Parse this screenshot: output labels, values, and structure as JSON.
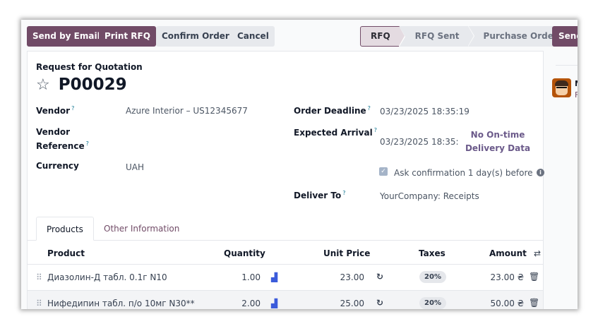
{
  "toolbar": {
    "send_by_email": "Send by Email",
    "print_rfq": "Print RFQ",
    "confirm_order": "Confirm Order",
    "cancel": "Cancel"
  },
  "status_bar": {
    "stages": [
      "RFQ",
      "RFQ Sent",
      "Purchase Order"
    ],
    "active_stage": "RFQ"
  },
  "right_panel": {
    "send_button": "Send",
    "name_initial": "M",
    "sub_initial": "F"
  },
  "form": {
    "doc_type": "Request for Quotation",
    "reference": "P00029",
    "vendor_label": "Vendor",
    "vendor_value": "Azure Interior – US12345677",
    "vendor_ref_label_1": "Vendor",
    "vendor_ref_label_2": "Reference",
    "currency_label": "Currency",
    "currency_value": "UAH",
    "order_deadline_label": "Order Deadline",
    "order_deadline_value": "03/23/2025 18:35:19",
    "expected_arrival_label": "Expected Arrival",
    "expected_arrival_value": "03/23/2025 18:35:",
    "no_ontime_line1": "No On-time",
    "no_ontime_line2": "Delivery Data",
    "ask_confirmation": "Ask confirmation",
    "ask_days": "1",
    "ask_suffix": "day(s) before",
    "deliver_to_label": "Deliver To",
    "deliver_to_value": "YourCompany: Receipts",
    "help_mark": "?"
  },
  "tabs": [
    "Products",
    "Other Information"
  ],
  "table": {
    "headers": {
      "product": "Product",
      "quantity": "Quantity",
      "unit_price": "Unit Price",
      "taxes": "Taxes",
      "amount": "Amount"
    },
    "rows": [
      {
        "product": "Диазолин-Д табл. 0.1г N10",
        "quantity": "1.00",
        "unit_price": "23.00",
        "tax": "20%",
        "amount": "23.00 ₴"
      },
      {
        "product": "Нифедипин табл. п/о 10мг N30**",
        "quantity": "2.00",
        "unit_price": "25.00",
        "tax": "20%",
        "amount": "50.00 ₴"
      }
    ]
  },
  "colors": {
    "primary": "#714b67",
    "secondary": "#e7e9ed",
    "link": "#6b5a8a"
  }
}
